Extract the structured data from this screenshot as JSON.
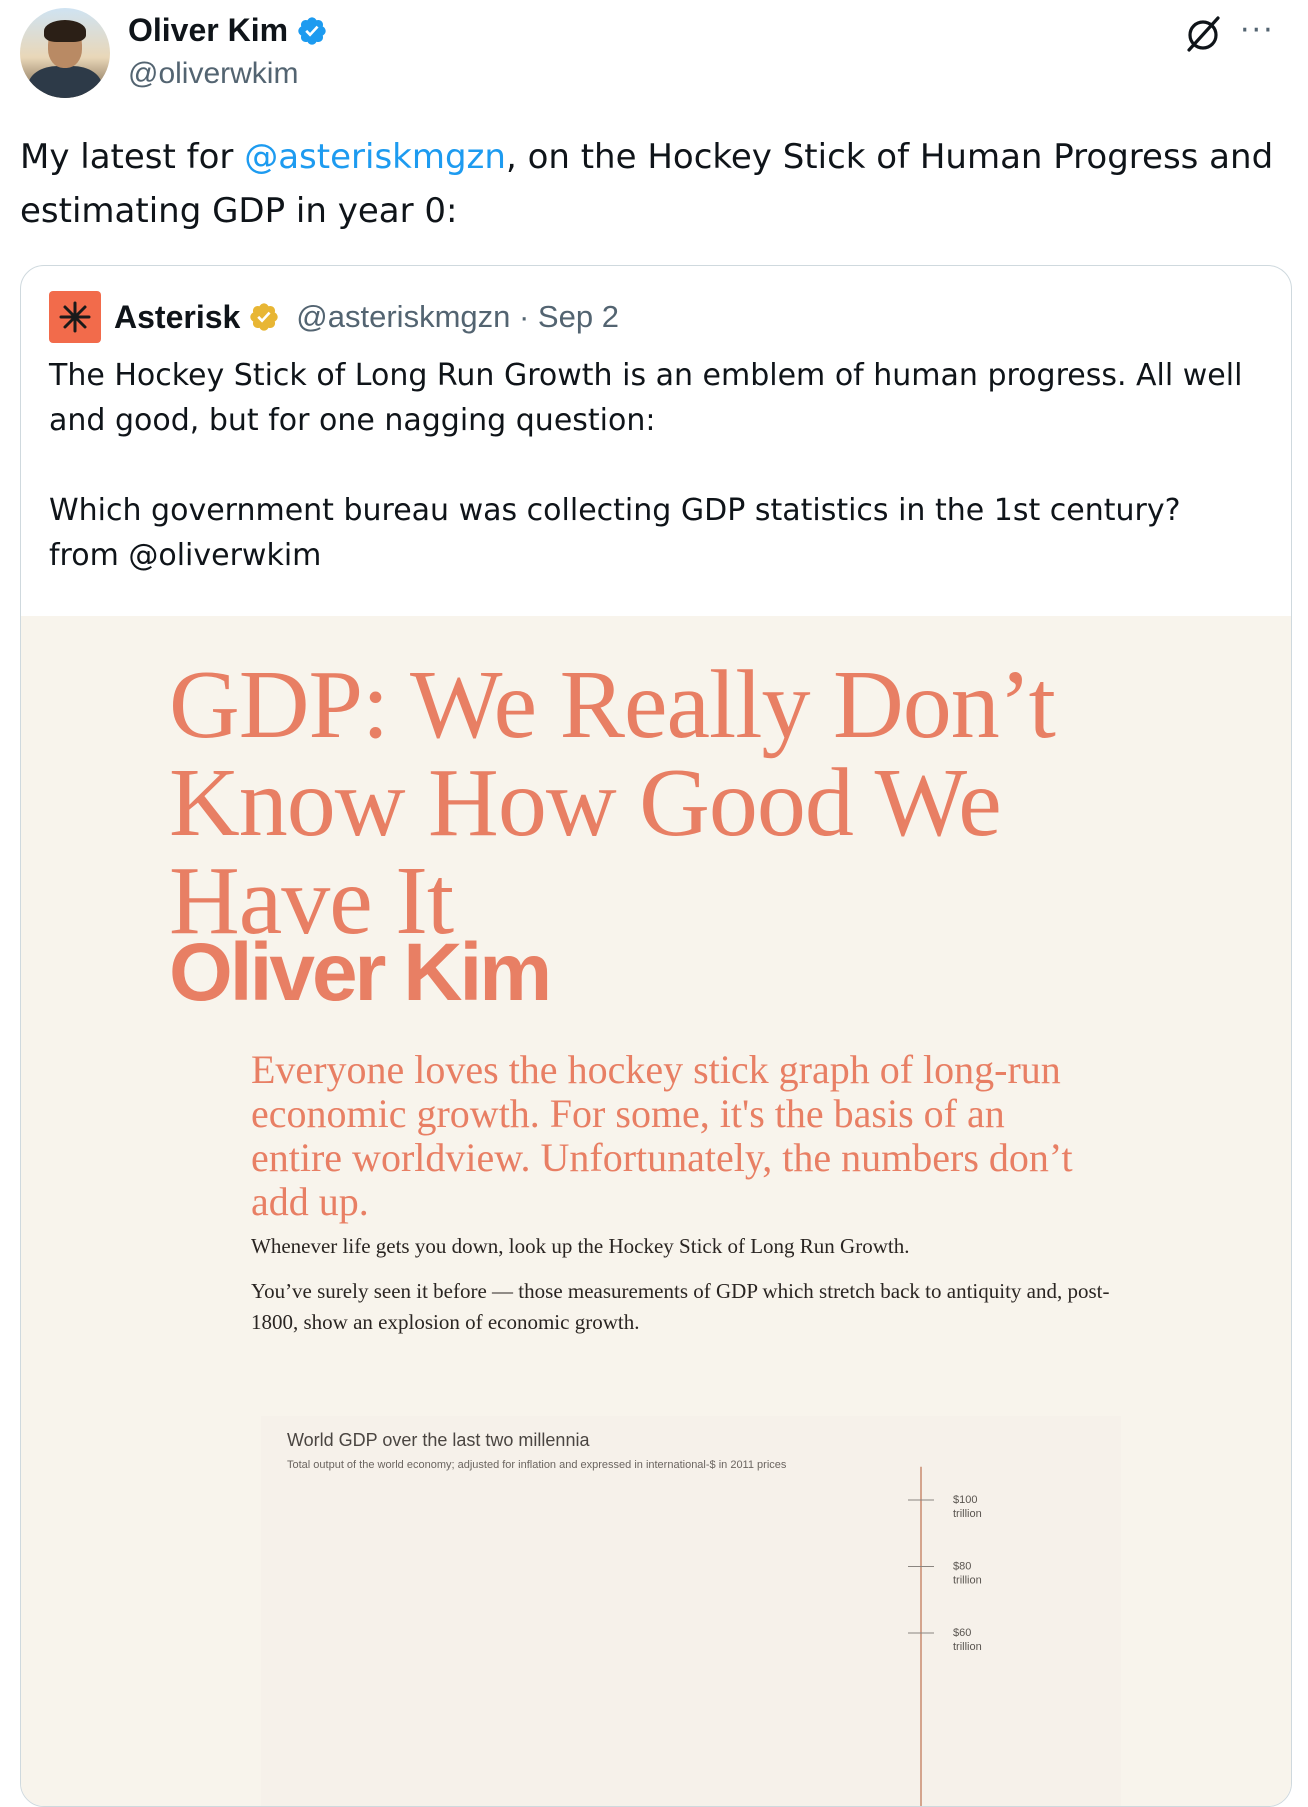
{
  "author": {
    "display_name": "Oliver Kim",
    "handle": "@oliverwkim",
    "verified_color": "#1d9bf0"
  },
  "header": {
    "grok_icon": "grok-icon",
    "more_icon": "more-icon",
    "more_label": "···"
  },
  "tweet": {
    "text_before": "My latest for ",
    "mention": "@asteriskmgzn",
    "text_after": ", on the Hockey Stick of Human Progress and estimating GDP in year 0:"
  },
  "quote": {
    "name": "Asterisk",
    "handle_date": "@asteriskmgzn · Sep 2",
    "logo_color": "#f26b4b",
    "badge_color": "#e8b634",
    "paragraph_1": "The Hockey Stick of Long Run Growth is an emblem of human progress. All well and good, but for one nagging question:",
    "paragraph_2": "Which government bureau was collecting GDP statistics in the 1st century? from @oliverwkim"
  },
  "article": {
    "accent_color": "#e87f64",
    "title_lines": [
      "GDP: We Really Don’t",
      "Know How Good We",
      "Have It"
    ],
    "author": "Oliver Kim",
    "dek_lines": [
      "Everyone loves the hockey stick graph of long-run",
      "economic growth. For some, it's the basis of an",
      "entire worldview. Unfortunately, the numbers don’t",
      "add up."
    ],
    "para_1": "Whenever life gets you down, look up the Hockey Stick of Long Run Growth.",
    "para_2": "You’ve surely seen it before — those measurements of GDP which stretch back to antiquity and, post-1800, show an explosion of economic growth."
  },
  "chart_data": {
    "type": "line",
    "title": "World GDP over the last two millennia",
    "subtitle": "Total output of the world economy; adjusted for inflation and expressed in international-$ in 2011 prices",
    "y_ticks": [
      {
        "value": 100,
        "label_1": "$100",
        "label_2": "trillion"
      },
      {
        "value": 80,
        "label_1": "$80",
        "label_2": "trillion"
      },
      {
        "value": 60,
        "label_1": "$60",
        "label_2": "trillion"
      }
    ],
    "ylim": [
      0,
      110
    ],
    "y_unit": "trillion"
  }
}
